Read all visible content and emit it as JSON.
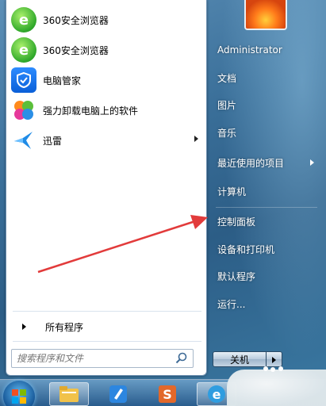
{
  "programs": [
    {
      "label": "360安全浏览器",
      "icon": "ie-browser-icon",
      "has_submenu": false
    },
    {
      "label": "360安全浏览器",
      "icon": "ie-browser-icon",
      "has_submenu": false
    },
    {
      "label": "电脑管家",
      "icon": "shield-icon",
      "has_submenu": false
    },
    {
      "label": "强力卸载电脑上的软件",
      "icon": "clover-icon",
      "has_submenu": false
    },
    {
      "label": "迅雷",
      "icon": "bird-icon",
      "has_submenu": true
    }
  ],
  "all_programs_label": "所有程序",
  "search": {
    "placeholder": "搜索程序和文件"
  },
  "right_items": [
    {
      "label": "Administrator",
      "has_submenu": false
    },
    {
      "label": "文档",
      "has_submenu": false
    },
    {
      "label": "图片",
      "has_submenu": false
    },
    {
      "label": "音乐",
      "has_submenu": false
    },
    {
      "label": "最近使用的项目",
      "has_submenu": true
    },
    {
      "label": "计算机",
      "has_submenu": false
    },
    {
      "label": "控制面板",
      "has_submenu": false
    },
    {
      "label": "设备和打印机",
      "has_submenu": false
    },
    {
      "label": "默认程序",
      "has_submenu": false
    },
    {
      "label": "运行...",
      "has_submenu": false
    }
  ],
  "shutdown_label": "关机",
  "colors": {
    "annotation_arrow": "#e23b3b",
    "accent_blue": "#1a5c9c"
  },
  "taskbar": {
    "items": [
      "start-orb-icon",
      "explorer-icon",
      "pen-icon",
      "s-app-icon",
      "ie-browser-icon"
    ]
  }
}
